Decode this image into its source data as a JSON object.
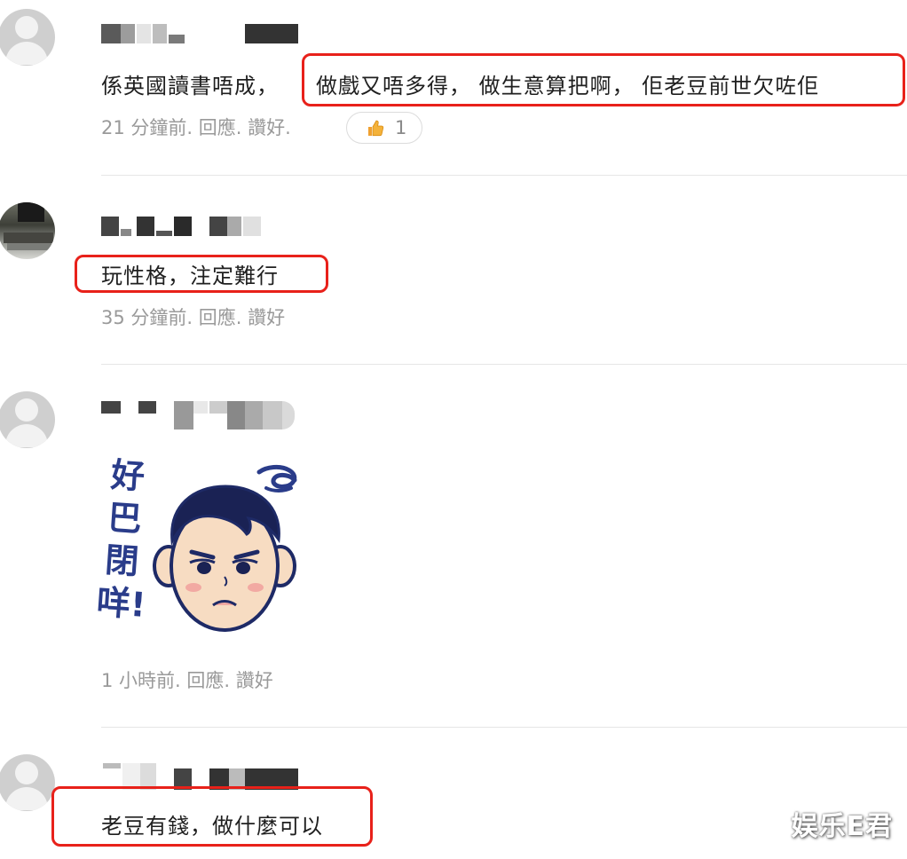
{
  "comments": [
    {
      "text_plain": "係英國讀書唔成，",
      "text_highlight": "做戲又唔多得， 做生意算把啊， 佢老豆前世欠咗佢",
      "time": "21 分鐘前",
      "reply": "回應",
      "like": "讚好",
      "like_count": "1"
    },
    {
      "text_highlight": "玩性格，注定難行",
      "time": "35 分鐘前",
      "reply": "回應",
      "like": "讚好"
    },
    {
      "sticker_text": "好巴閉咩!",
      "time": "1 小時前",
      "reply": "回應",
      "like": "讚好"
    },
    {
      "text_highlight": "老豆有錢，做什麼可以"
    }
  ],
  "meta_separator": ".",
  "watermark": "娱乐E君",
  "colors": {
    "highlight": "#e8211a",
    "meta": "#9a9a9a",
    "sticker_ink": "#2a3c8a"
  }
}
